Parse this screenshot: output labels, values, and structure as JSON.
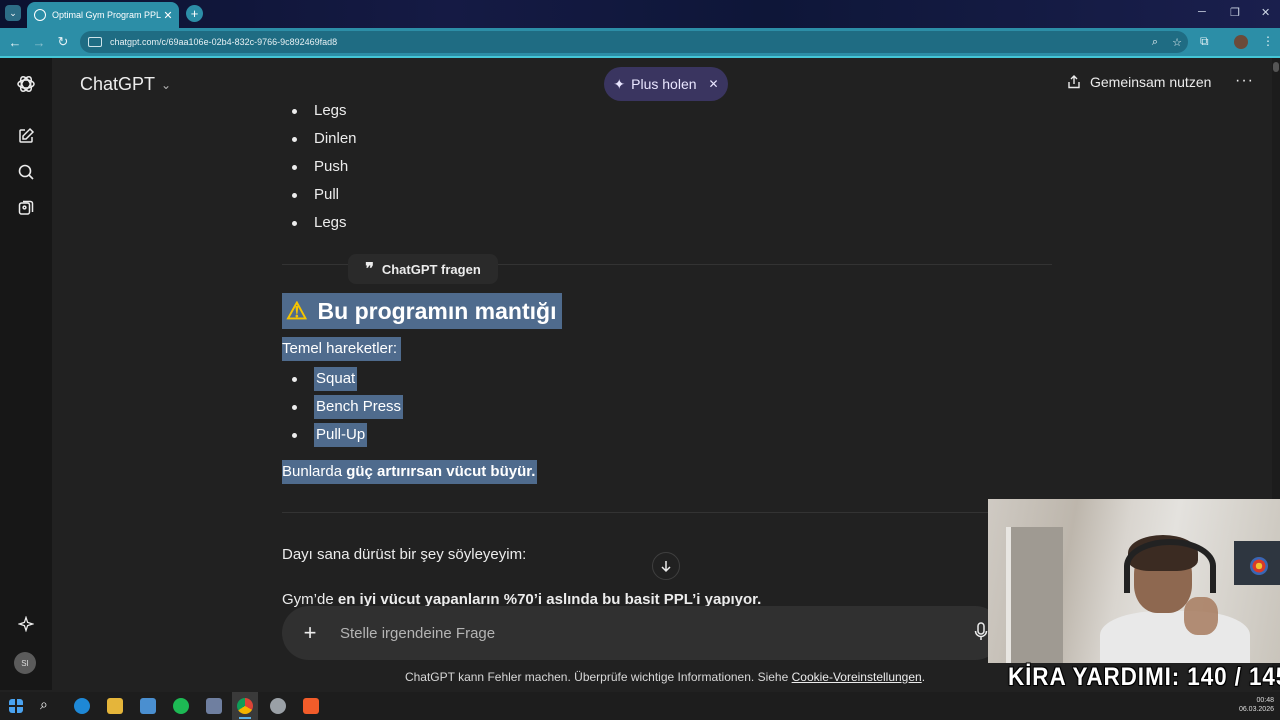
{
  "browser": {
    "tab_title": "Optimal Gym Program PPL",
    "url": "chatgpt.com/c/69aa106e-02b4-832c-9766-9c892469fad8"
  },
  "header": {
    "app_title": "ChatGPT",
    "plus_label": "Plus holen",
    "share_label": "Gemeinsam nutzen"
  },
  "sidebar": {
    "icons": [
      "new-chat-icon",
      "search-icon",
      "library-icon"
    ],
    "avatar_initials": "SI"
  },
  "conversation": {
    "top_bullets": [
      "Legs",
      "Dinlen",
      "Push",
      "Pull",
      "Legs"
    ],
    "ask_popup": "ChatGPT fragen",
    "heading_emoji": "⚠",
    "heading": "Bu programın mantığı",
    "temel_label": "Temel hareketler:",
    "exercises": [
      "Squat",
      "Bench Press",
      "Pull-Up"
    ],
    "bunlarda_prefix": "Bunlarda ",
    "bunlarda_bold": "güç artırırsan vücut büyür.",
    "dayi_text": "Dayı sana dürüst bir şey söyleyeyim:",
    "gym_prefix": "Gym’de ",
    "gym_bold": "en iyi vücut yapanların %70’i aslında bu basit PPL’i yapıyor."
  },
  "composer": {
    "placeholder": "Stelle irgendeine Frage"
  },
  "footer": {
    "disclaimer_text": "ChatGPT kann Fehler machen. Überprüfe wichtige Informationen. Siehe ",
    "disclaimer_link": "Cookie-Voreinstellungen",
    "disclaimer_end": "."
  },
  "overlay": {
    "counter_text": "KİRA YARDIMI:  140 / 145"
  },
  "taskbar": {
    "time": "00:48",
    "date": "06.03.2026"
  },
  "colors": {
    "background": "#212121",
    "selection": "#4f6b8d",
    "plus_pill": "#3a3560",
    "browser_accent": "#2c8ea7"
  }
}
